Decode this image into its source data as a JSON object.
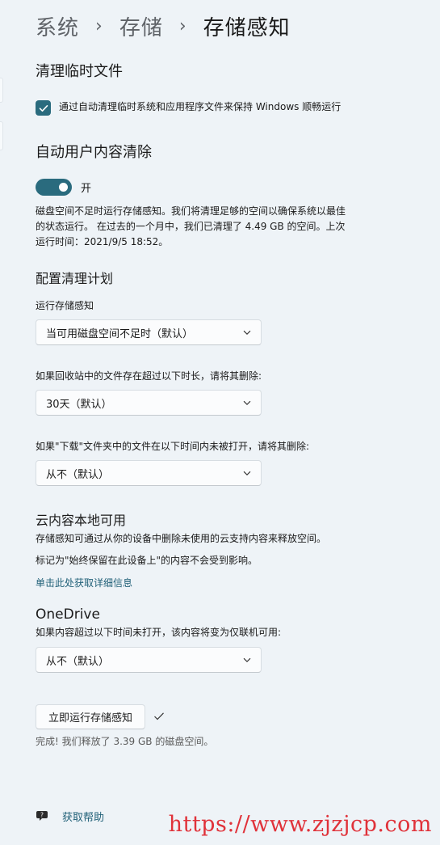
{
  "breadcrumb": {
    "items": [
      "系统",
      "存储"
    ],
    "separator": "›",
    "current": "存储感知"
  },
  "temp_files": {
    "heading": "清理临时文件",
    "checkbox_label": "通过自动清理临时系统和应用程序文件来保持 Windows 顺畅运行",
    "checked": true
  },
  "auto_cleanup": {
    "heading": "自动用户内容清除",
    "toggle_label": "开",
    "toggle_on": true,
    "description_lines": [
      "磁盘空间不足时运行存储感知。我们将清理足够的空间以确保系统以最佳",
      "的状态运行。 在过去的一个月中，我们已清理了 4.49 GB 的空间。上次",
      "运行时间：2021/9/5 18:52。"
    ]
  },
  "schedule": {
    "heading": "配置清理计划",
    "run_label": "运行存储感知",
    "run_value": "当可用磁盘空间不足时（默认）",
    "recycle_label": "如果回收站中的文件存在超过以下时长，请将其删除:",
    "recycle_value": "30天（默认）",
    "downloads_label": "如果\"下载\"文件夹中的文件在以下时间内未被打开，请将其删除:",
    "downloads_value": "从不（默认）"
  },
  "cloud": {
    "heading": "云内容本地可用",
    "line1": "存储感知可通过从你的设备中删除未使用的云支持内容来释放空间。",
    "line2": "标记为\"始终保留在此设备上\"的内容不会受到影响。",
    "link": "单击此处获取详细信息"
  },
  "onedrive": {
    "heading": "OneDrive",
    "label": "如果内容超过以下时间未打开，该内容将变为仅联机可用:",
    "value": "从不（默认）"
  },
  "run_now": {
    "button_label": "立即运行存储感知",
    "status": "完成! 我们释放了 3.39 GB 的磁盘空间。"
  },
  "help": {
    "label": "获取帮助",
    "icon": "help-chat-icon"
  },
  "watermark": "https://www.zjzjcp.com",
  "colors": {
    "accent": "#2a6b7e",
    "link": "#1f5f77",
    "background": "#eef3f7",
    "watermark": "#e0323a"
  }
}
